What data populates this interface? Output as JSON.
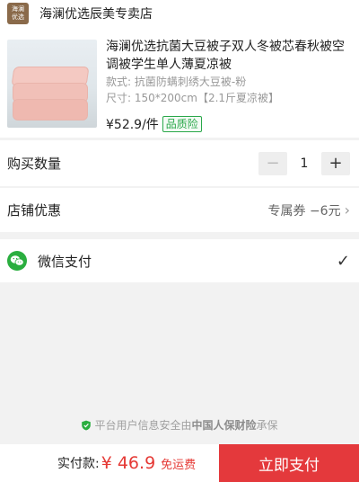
{
  "shop": {
    "logo_line1": "海澜",
    "logo_line2": "优选",
    "name": "海澜优选辰美专卖店"
  },
  "product": {
    "title": "海澜优选抗菌大豆被子双人冬被芯春秋被空调被学生单人薄夏凉被",
    "style_spec": "款式: 抗菌防螨刺绣大豆被-粉",
    "size_spec": "尺寸: 150*200cm【2.1斤夏凉被】",
    "price": "¥52.9/件",
    "badge": "品质险"
  },
  "quantity": {
    "label": "购买数量",
    "minus": "−",
    "value": "1",
    "plus": "+"
  },
  "discount": {
    "label": "店铺优惠",
    "value": "专属券 −6元",
    "chevron": "›"
  },
  "payment": {
    "method": "微信支付",
    "icon": "wechat-icon",
    "selected_mark": "✓"
  },
  "security": {
    "prefix": "平台用户信息安全由",
    "insurer": "中国人保财险",
    "suffix": "承保"
  },
  "footer": {
    "total_label": "实付款:",
    "total_amount": "¥ 46.9",
    "free_shipping": "免运费",
    "pay_button": "立即支付"
  },
  "colors": {
    "accent_red": "#e4393c",
    "price_red": "#e53935",
    "wechat_green": "#2aae3f",
    "badge_green": "#2aa84a"
  }
}
